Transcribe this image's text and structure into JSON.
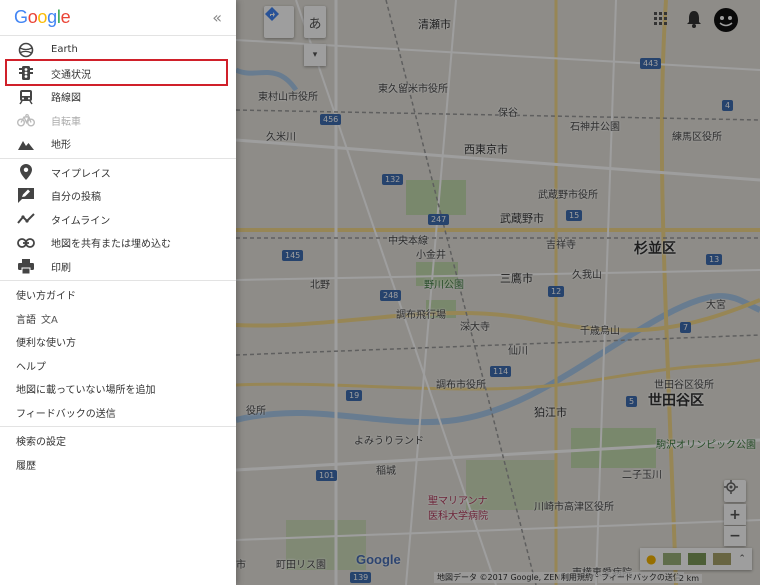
{
  "sidebar": {
    "logo": [
      "G",
      "o",
      "o",
      "g",
      "l",
      "e"
    ],
    "collapse_icon": "double-chevron-left-icon",
    "layers": [
      {
        "label": "Earth",
        "icon": "globe-icon"
      },
      {
        "label": "交通状況",
        "icon": "traffic-light-icon"
      },
      {
        "label": "路線図",
        "icon": "train-icon"
      },
      {
        "label": "自転車",
        "icon": "bicycle-icon",
        "disabled": true
      },
      {
        "label": "地形",
        "icon": "terrain-icon"
      }
    ],
    "personal": [
      {
        "label": "マイプレイス",
        "icon": "pin-icon"
      },
      {
        "label": "自分の投稿",
        "icon": "edit-icon"
      },
      {
        "label": "タイムライン",
        "icon": "timeline-icon"
      },
      {
        "label": "地図を共有または埋め込む",
        "icon": "link-icon"
      },
      {
        "label": "印刷",
        "icon": "printer-icon"
      }
    ],
    "help": [
      "使い方ガイド",
      "言語",
      "便利な使い方",
      "ヘルプ",
      "地図に載っていない場所を追加",
      "フィードバックの送信"
    ],
    "help_lang_glyph": "文A",
    "settings": [
      "検索の設定",
      "履歴"
    ]
  },
  "map": {
    "labels": {
      "kiyose": "清瀬市",
      "higashimurayama": "東村山市役所",
      "higashikurume": "東久留米市役所",
      "nishitokyo": "西東京市",
      "musashino_city": "武蔵野市",
      "musashino_office": "武蔵野市役所",
      "suginami": "杉並区",
      "nerima": "練馬区役所",
      "mitaka": "三鷹市",
      "nogawa": "野川公園",
      "chofu_airport": "調布飛行場",
      "jindaiji": "深大寺",
      "chofu_office": "調布市役所",
      "komae": "狛江市",
      "setagaya": "世田谷区",
      "setagaya_office": "世田谷区役所",
      "yomiuri": "よみうりランド",
      "marianna": "聖マリアンナ\n医科大学病院",
      "takatsu": "川崎市高津区役所",
      "toyoko": "東横恵愛病院",
      "komazawa": "駒沢オリンピック公園",
      "machida": "町田リス園",
      "chuo": "中央本線",
      "koganei": "小金井",
      "shiyakusho": "役所",
      "shiritsu": "市役所",
      "hoya": "保谷",
      "shakujii": "石神井公園",
      "kichijoji": "吉祥寺",
      "kugayama": "久我山",
      "sengawa": "仙川",
      "kitano": "北野",
      "chitose": "千歳烏山",
      "futako": "二子玉川",
      "inagi": "稲城",
      "omiya": "大宮",
      "kubo": "久米川",
      "ichi": "市"
    },
    "route_numbers": [
      "443",
      "4",
      "456",
      "132",
      "247",
      "15",
      "12",
      "145",
      "248",
      "114",
      "13",
      "19",
      "7",
      "101",
      "139",
      "5"
    ],
    "search_glyph": "あ",
    "footer": {
      "copyright": "地図データ ©2017 Google, ZENRIN",
      "terms": "利用規約",
      "feedback": "フィードバックの送信",
      "scale": "2 km"
    },
    "google_mark": "Google",
    "zoom_in": "+",
    "zoom_out": "−"
  }
}
